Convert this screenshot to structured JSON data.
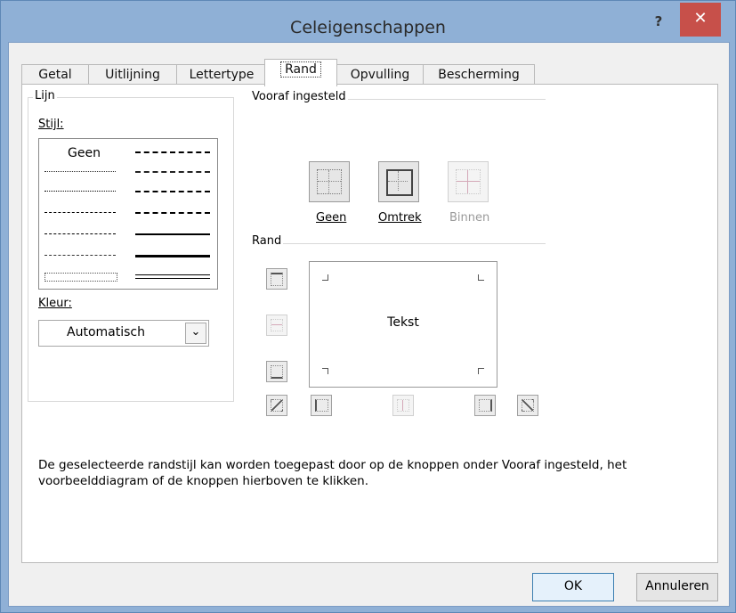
{
  "window": {
    "title": "Celeigenschappen",
    "help_label": "?",
    "close_label": "✕"
  },
  "tabs": [
    {
      "label": "Getal"
    },
    {
      "label": "Uitlijning"
    },
    {
      "label": "Lettertype"
    },
    {
      "label": "Rand"
    },
    {
      "label": "Opvulling"
    },
    {
      "label": "Bescherming"
    }
  ],
  "active_tab": "Rand",
  "line_group": {
    "legend": "Lijn",
    "style_label": "Stijl:",
    "style_none": "Geen",
    "color_label": "Kleur:",
    "color_value": "Automatisch",
    "color_dropdown_icon": "chevron-down-icon"
  },
  "presets": {
    "legend": "Vooraf ingesteld",
    "items": [
      {
        "label": "Geen",
        "icon": "border-none-icon",
        "enabled": true
      },
      {
        "label": "Omtrek",
        "icon": "border-outline-icon",
        "enabled": true
      },
      {
        "label": "Binnen",
        "icon": "border-inside-icon",
        "enabled": false
      }
    ]
  },
  "border": {
    "legend": "Rand",
    "preview_text": "Tekst"
  },
  "description": "De geselecteerde randstijl kan worden toegepast door op de knoppen onder Vooraf ingesteld, het voorbeelddiagram of de knoppen hierboven te klikken.",
  "buttons": {
    "ok": "OK",
    "cancel": "Annuleren"
  }
}
